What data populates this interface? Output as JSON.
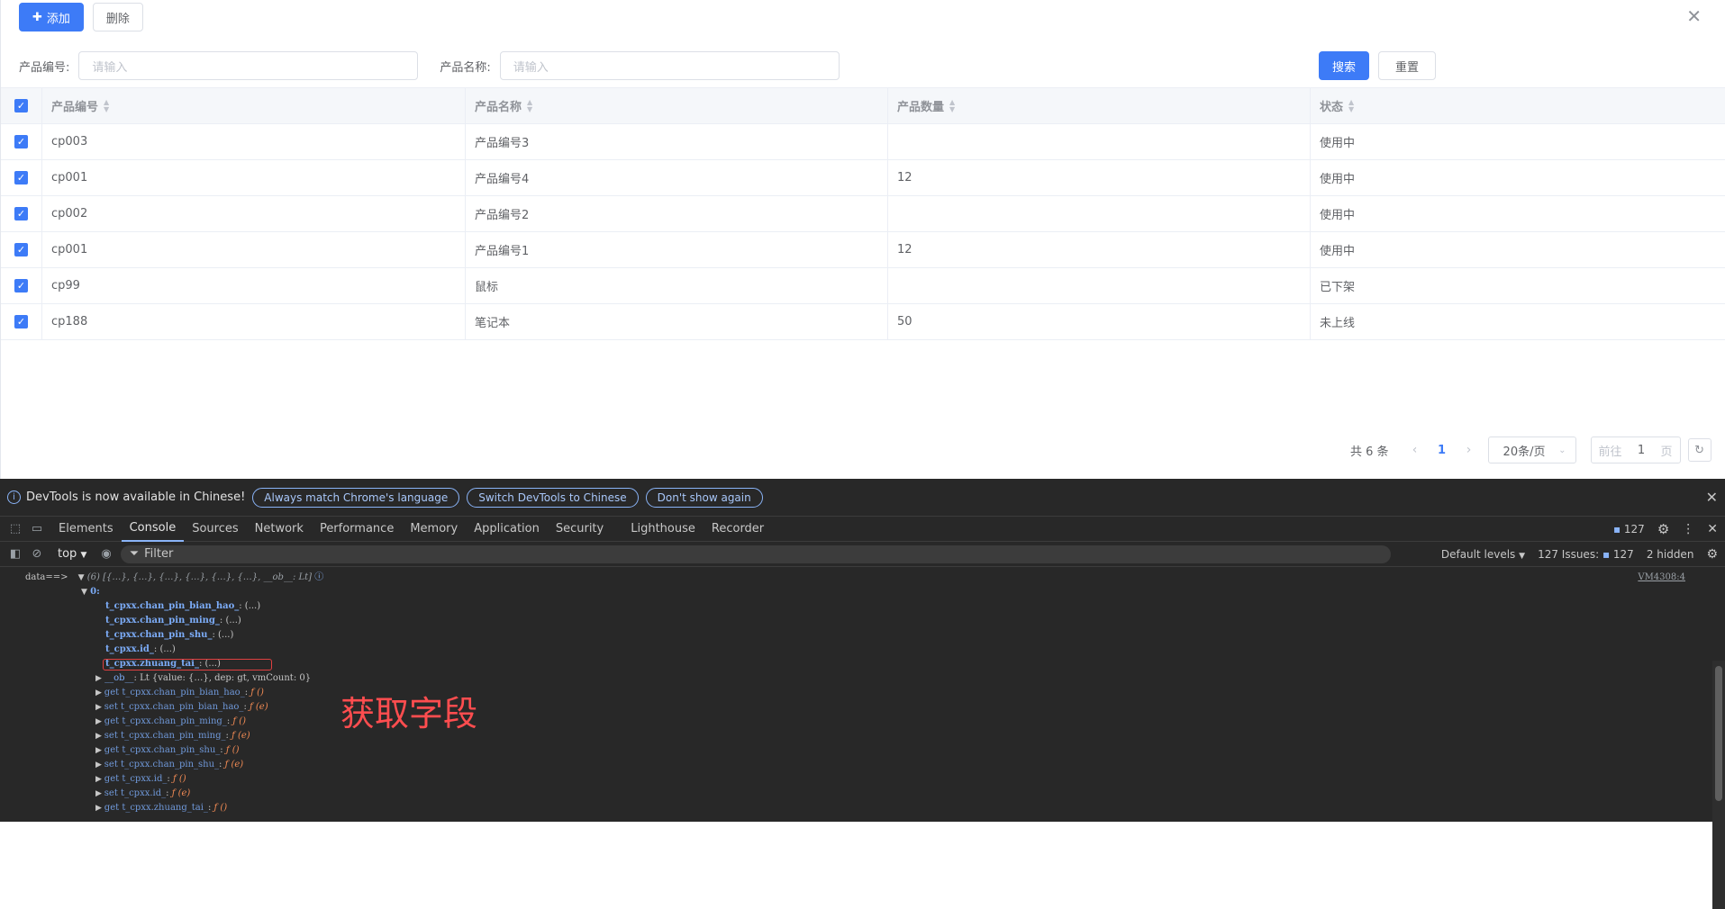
{
  "toolbar": {
    "add_label": "添加",
    "delete_label": "删除"
  },
  "search": {
    "code_label": "产品编号:",
    "code_placeholder": "请输入",
    "name_label": "产品名称:",
    "name_placeholder": "请输入",
    "search_label": "搜索",
    "reset_label": "重置"
  },
  "table": {
    "headers": [
      "产品编号",
      "产品名称",
      "产品数量",
      "状态"
    ],
    "rows": [
      [
        "cp003",
        "产品编号3",
        "",
        "使用中"
      ],
      [
        "cp001",
        "产品编号4",
        "12",
        "使用中"
      ],
      [
        "cp002",
        "产品编号2",
        "",
        "使用中"
      ],
      [
        "cp001",
        "产品编号1",
        "12",
        "使用中"
      ],
      [
        "cp99",
        "鼠标",
        "",
        "已下架"
      ],
      [
        "cp188",
        "笔记本",
        "50",
        "未上线"
      ]
    ]
  },
  "pagination": {
    "total": "共 6 条",
    "current": "1",
    "page_size": "20条/页",
    "goto_prefix": "前往",
    "goto_value": "1",
    "goto_suffix": "页"
  },
  "devtools": {
    "info_text": "DevTools is now available in Chinese!",
    "btn_match": "Always match Chrome's language",
    "btn_switch": "Switch DevTools to Chinese",
    "btn_dont": "Don't show again",
    "tabs": [
      "Elements",
      "Console",
      "Sources",
      "Network",
      "Performance",
      "Memory",
      "Application",
      "Security",
      "Lighthouse",
      "Recorder"
    ],
    "issues_badge": "127",
    "context": "top",
    "filter_placeholder": "Filter",
    "levels": "Default levels",
    "issues_label": "127 Issues:",
    "issues_count": "127",
    "hidden": "2 hidden",
    "source_link": "VM4308:4",
    "annotation": "获取字段"
  },
  "console": {
    "line0_prefix": "data==>",
    "line0_value": "(6) [{…}, {…}, {…}, {…}, {…}, {…}, __ob__: Lt]",
    "line1": "0:",
    "props": [
      {
        "key": "t_cpxx.chan_pin_bian_hao_",
        "val": ": (...)"
      },
      {
        "key": "t_cpxx.chan_pin_ming_",
        "val": ": (...)"
      },
      {
        "key": "t_cpxx.chan_pin_shu_",
        "val": ": (...)"
      },
      {
        "key": "t_cpxx.id_",
        "val": ": (...)"
      },
      {
        "key": "t_cpxx.zhuang_tai_",
        "val": ": (...)"
      }
    ],
    "ob_key": "__ob__",
    "ob_val": ": Lt  {value: {…}, dep: gt, vmCount: 0}",
    "accessors": [
      {
        "prefix": "get t_cpxx.chan_pin_bian_hao_",
        "fn": "ƒ ()"
      },
      {
        "prefix": "set t_cpxx.chan_pin_bian_hao_",
        "fn": "ƒ (e)"
      },
      {
        "prefix": "get t_cpxx.chan_pin_ming_",
        "fn": "ƒ ()"
      },
      {
        "prefix": "set t_cpxx.chan_pin_ming_",
        "fn": "ƒ (e)"
      },
      {
        "prefix": "get t_cpxx.chan_pin_shu_",
        "fn": "ƒ ()"
      },
      {
        "prefix": "set t_cpxx.chan_pin_shu_",
        "fn": "ƒ (e)"
      },
      {
        "prefix": "get t_cpxx.id_",
        "fn": "ƒ ()"
      },
      {
        "prefix": "set t_cpxx.id_",
        "fn": "ƒ (e)"
      },
      {
        "prefix": "get t_cpxx.zhuang_tai_",
        "fn": "ƒ ()"
      }
    ]
  },
  "colors": {
    "primary": "#3d7bf7",
    "devtools_bg": "#282828",
    "annotation": "#ff4d4f"
  }
}
